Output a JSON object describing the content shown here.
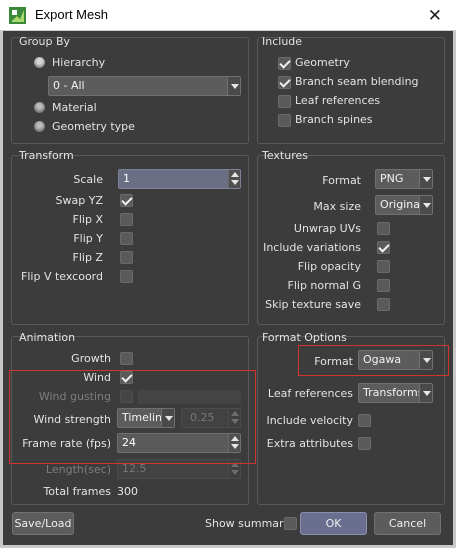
{
  "window": {
    "title": "Export Mesh",
    "close_glyph": "✕"
  },
  "group_by": {
    "label": "Group By",
    "hierarchy_label": "Hierarchy",
    "hierarchy_selected": true,
    "hierarchy_combo": "0 - All",
    "material_label": "Material",
    "geometry_type_label": "Geometry type"
  },
  "include": {
    "label": "Include",
    "items": [
      {
        "label": "Geometry",
        "checked": true
      },
      {
        "label": "Branch seam blending",
        "checked": true
      },
      {
        "label": "Leaf references",
        "checked": false
      },
      {
        "label": "Branch spines",
        "checked": false
      }
    ]
  },
  "transform": {
    "label": "Transform",
    "scale_label": "Scale",
    "scale_value": "1",
    "swap_yz_label": "Swap YZ",
    "swap_yz": true,
    "flip_x_label": "Flip X",
    "flip_y_label": "Flip Y",
    "flip_z_label": "Flip Z",
    "flip_v_label": "Flip V texcoord"
  },
  "textures": {
    "label": "Textures",
    "format_label": "Format",
    "format_value": "PNG",
    "max_size_label": "Max size",
    "max_size_value": "Original",
    "unwrap_uvs_label": "Unwrap UVs",
    "include_variations_label": "Include variations",
    "include_variations": true,
    "flip_opacity_label": "Flip opacity",
    "flip_normal_g_label": "Flip normal G",
    "skip_texture_save_label": "Skip texture save"
  },
  "animation": {
    "label": "Animation",
    "growth_label": "Growth",
    "wind_label": "Wind",
    "wind": true,
    "wind_gusting_label": "Wind gusting",
    "wind_strength_label": "Wind strength",
    "wind_strength_mode": "Timeline",
    "wind_strength_value": "0.25",
    "frame_rate_label": "Frame rate (fps)",
    "frame_rate_value": "24",
    "length_label": "Length(sec)",
    "length_value": "12.5",
    "total_frames_label": "Total frames",
    "total_frames_value": "300"
  },
  "format_options": {
    "label": "Format Options",
    "format_label": "Format",
    "format_value": "Ogawa",
    "leaf_references_label": "Leaf references",
    "leaf_references_value": "Transforms",
    "include_velocity_label": "Include velocity",
    "extra_attributes_label": "Extra attributes"
  },
  "footer": {
    "save_load_label": "Save/Load",
    "show_summary_label": "Show summary",
    "ok_label": "OK",
    "cancel_label": "Cancel"
  },
  "colors": {
    "dialog_bg": "#3c3c3c",
    "highlight": "#d23232",
    "accent": "#6b6f85"
  }
}
